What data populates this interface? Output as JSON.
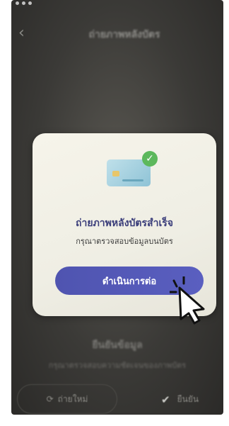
{
  "nav": {
    "title": "ถ่ายภาพหลังบัตร"
  },
  "modal": {
    "title": "ถ่ายภาพหลังบัตรสำเร็จ",
    "subtitle": "กรุณาตรวจสอบข้อมูลบนบัตร",
    "continue_label": "ดำเนินการต่อ"
  },
  "background": {
    "heading": "ยืนยันข้อมูล",
    "subtext": "กรุณาตรวจสอบความชัดเจนของภาพบัตร",
    "retake_label": "ถ่ายใหม่",
    "confirm_label": "ยืนยัน"
  }
}
